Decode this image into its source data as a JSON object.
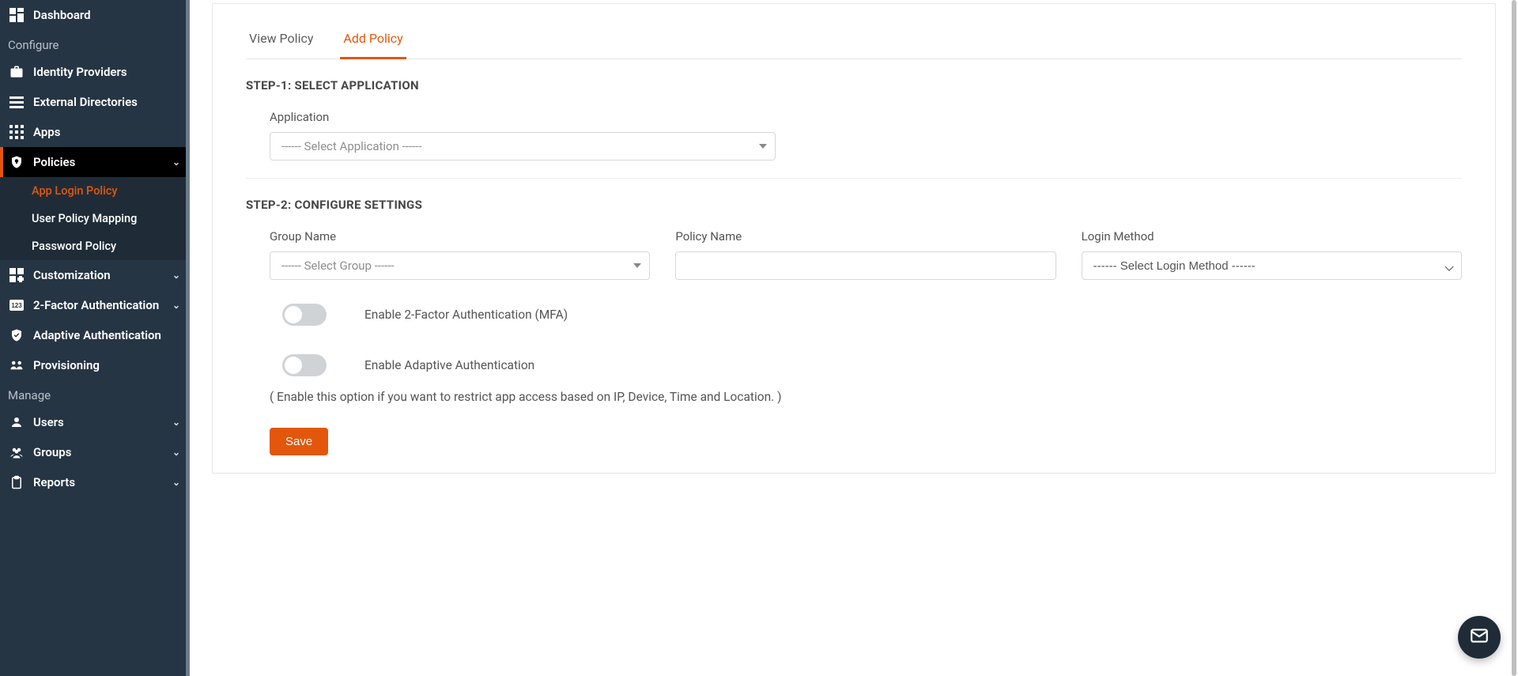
{
  "sidebar": {
    "dashboard": "Dashboard",
    "group_configure": "Configure",
    "identity_providers": "Identity Providers",
    "external_directories": "External Directories",
    "apps": "Apps",
    "policies": "Policies",
    "policies_sub": {
      "app_login": "App Login Policy",
      "user_mapping": "User Policy Mapping",
      "password": "Password Policy"
    },
    "customization": "Customization",
    "two_factor": "2-Factor Authentication",
    "adaptive_auth": "Adaptive Authentication",
    "provisioning": "Provisioning",
    "group_manage": "Manage",
    "users": "Users",
    "groups": "Groups",
    "reports": "Reports"
  },
  "tabs": {
    "view": "View Policy",
    "add": "Add Policy"
  },
  "step1": {
    "title": "STEP-1: SELECT APPLICATION",
    "app_label": "Application",
    "app_placeholder": "------ Select Application ------"
  },
  "step2": {
    "title": "STEP-2: CONFIGURE SETTINGS",
    "group_label": "Group Name",
    "group_placeholder": "------ Select Group ------",
    "policy_label": "Policy Name",
    "login_label": "Login Method",
    "login_placeholder": "------ Select Login Method ------",
    "toggle_mfa": "Enable 2-Factor Authentication (MFA)",
    "toggle_adaptive": "Enable Adaptive Authentication",
    "adaptive_hint": "( Enable this option if you want to restrict app access based on IP, Device, Time and Location. )",
    "save": "Save"
  }
}
